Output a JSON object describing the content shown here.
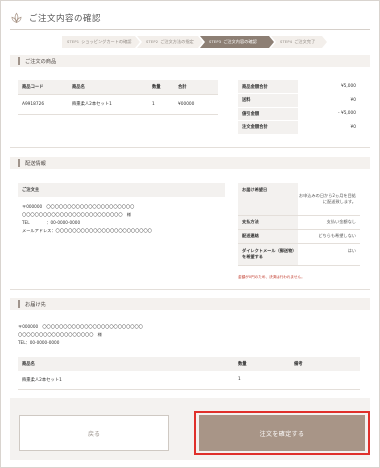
{
  "page": {
    "title": "ご注文内容の確認"
  },
  "steps": [
    {
      "num": "STEP1",
      "label": "ショッピングカートの確認"
    },
    {
      "num": "STEP2",
      "label": "ご注文方法の指定"
    },
    {
      "num": "STEP3",
      "label": "ご注文内容の確認"
    },
    {
      "num": "STEP4",
      "label": "ご注文完了"
    }
  ],
  "products": {
    "heading": "ご注文の商品",
    "columns": [
      "商品コード",
      "商品名",
      "数量",
      "合計"
    ],
    "rows": [
      {
        "code": "A9918726",
        "name": "飾棗柔人2本セット1",
        "qty": "1",
        "total": "¥00000"
      }
    ]
  },
  "summary": {
    "rows": [
      {
        "label": "商品金額合計",
        "value": "¥5,000"
      },
      {
        "label": "送料",
        "value": "¥0"
      },
      {
        "label": "値引金額",
        "value": "- ¥5,000"
      },
      {
        "label": "注文金額合計",
        "value": "¥0"
      }
    ]
  },
  "delivery_info": {
    "heading": "配送情報",
    "orderer_title": "ご注文主",
    "orderer_lines": [
      "〒000000　〇〇〇〇〇〇〇〇〇〇〇〇〇〇〇〇〇〇〇〇〇",
      "〇〇〇〇〇〇〇〇〇〇〇〇〇〇〇〇〇〇〇〇〇〇〇〇　様",
      "TEL　　　　：00-0000-0000",
      "メールアドレス：〇〇〇〇〇〇〇〇〇〇〇〇〇〇〇〇〇〇〇〇〇〇〇"
    ],
    "details": [
      {
        "label": "お届け希望日",
        "value": "お申込みの日から2ヵ月を目処に配送致します。"
      },
      {
        "label": "支払方法",
        "value": "支払い金額なし"
      },
      {
        "label": "配送連絡",
        "value": "どちらも希望しない"
      },
      {
        "label": "ダイレクトメール（郵送物）を希望する",
        "value": "はい"
      }
    ],
    "note": "金額が0円のため、決済は行われません。"
  },
  "ship_to": {
    "heading": "お届け先",
    "lines": [
      "〒000000　〇〇〇〇〇〇〇〇〇〇〇〇〇〇〇〇〇〇〇〇〇〇〇〇",
      "〇〇〇〇〇〇〇〇〇〇〇〇〇〇〇〇〇〇　様",
      "TEL：00-0000-0000"
    ],
    "columns": [
      "商品名",
      "数量",
      "備考"
    ],
    "rows": [
      {
        "name": "飾棗柔人2本セット1",
        "qty": "1",
        "note": ""
      }
    ]
  },
  "buttons": {
    "back": "戻る",
    "confirm": "注文を確定する"
  },
  "colors": {
    "accent": "#a89587",
    "active_step": "#8d7f74",
    "highlight_border": "#e0302b"
  }
}
